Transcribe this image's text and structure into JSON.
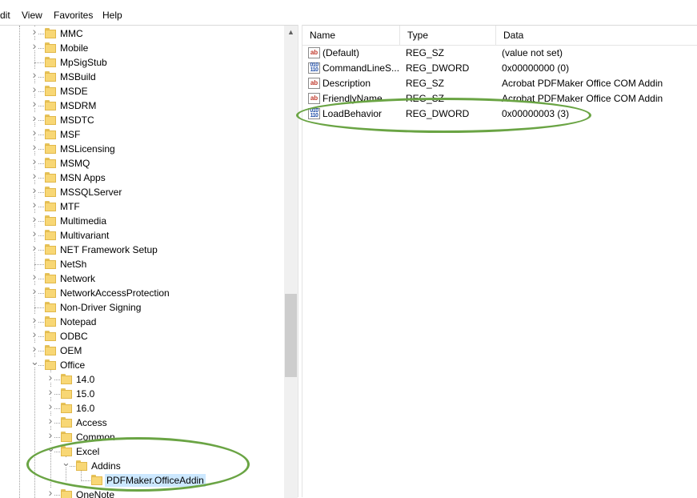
{
  "menu": {
    "items": [
      "dit",
      "View",
      "Favorites",
      "Help"
    ]
  },
  "tree": {
    "items": [
      {
        "label": "MMC",
        "depth": 0,
        "expander": "collapsed"
      },
      {
        "label": "Mobile",
        "depth": 0,
        "expander": "collapsed"
      },
      {
        "label": "MpSigStub",
        "depth": 0,
        "expander": "none"
      },
      {
        "label": "MSBuild",
        "depth": 0,
        "expander": "collapsed"
      },
      {
        "label": "MSDE",
        "depth": 0,
        "expander": "collapsed"
      },
      {
        "label": "MSDRM",
        "depth": 0,
        "expander": "collapsed"
      },
      {
        "label": "MSDTC",
        "depth": 0,
        "expander": "collapsed"
      },
      {
        "label": "MSF",
        "depth": 0,
        "expander": "collapsed"
      },
      {
        "label": "MSLicensing",
        "depth": 0,
        "expander": "collapsed"
      },
      {
        "label": "MSMQ",
        "depth": 0,
        "expander": "collapsed"
      },
      {
        "label": "MSN Apps",
        "depth": 0,
        "expander": "collapsed"
      },
      {
        "label": "MSSQLServer",
        "depth": 0,
        "expander": "collapsed"
      },
      {
        "label": "MTF",
        "depth": 0,
        "expander": "collapsed"
      },
      {
        "label": "Multimedia",
        "depth": 0,
        "expander": "collapsed"
      },
      {
        "label": "Multivariant",
        "depth": 0,
        "expander": "collapsed"
      },
      {
        "label": "NET Framework Setup",
        "depth": 0,
        "expander": "collapsed"
      },
      {
        "label": "NetSh",
        "depth": 0,
        "expander": "none"
      },
      {
        "label": "Network",
        "depth": 0,
        "expander": "collapsed"
      },
      {
        "label": "NetworkAccessProtection",
        "depth": 0,
        "expander": "collapsed"
      },
      {
        "label": "Non-Driver Signing",
        "depth": 0,
        "expander": "none"
      },
      {
        "label": "Notepad",
        "depth": 0,
        "expander": "collapsed"
      },
      {
        "label": "ODBC",
        "depth": 0,
        "expander": "collapsed"
      },
      {
        "label": "OEM",
        "depth": 0,
        "expander": "collapsed"
      },
      {
        "label": "Office",
        "depth": 0,
        "expander": "expanded"
      },
      {
        "label": "14.0",
        "depth": 1,
        "expander": "collapsed"
      },
      {
        "label": "15.0",
        "depth": 1,
        "expander": "collapsed"
      },
      {
        "label": "16.0",
        "depth": 1,
        "expander": "collapsed"
      },
      {
        "label": "Access",
        "depth": 1,
        "expander": "collapsed"
      },
      {
        "label": "Common",
        "depth": 1,
        "expander": "collapsed"
      },
      {
        "label": "Excel",
        "depth": 1,
        "expander": "expanded"
      },
      {
        "label": "Addins",
        "depth": 2,
        "expander": "expanded"
      },
      {
        "label": "PDFMaker.OfficeAddin",
        "depth": 3,
        "expander": "none",
        "selected": true
      },
      {
        "label": "OneNote",
        "depth": 1,
        "expander": "collapsed"
      }
    ]
  },
  "list": {
    "columns": [
      "Name",
      "Type",
      "Data"
    ],
    "rows": [
      {
        "icon": "string-value-icon",
        "name": "(Default)",
        "type": "REG_SZ",
        "data": "(value not set)"
      },
      {
        "icon": "dword-value-icon",
        "name": "CommandLineS...",
        "type": "REG_DWORD",
        "data": "0x00000000 (0)"
      },
      {
        "icon": "string-value-icon",
        "name": "Description",
        "type": "REG_SZ",
        "data": "Acrobat PDFMaker Office COM Addin"
      },
      {
        "icon": "string-value-icon",
        "name": "FriendlyName",
        "type": "REG_SZ",
        "data": "Acrobat PDFMaker Office COM Addin"
      },
      {
        "icon": "dword-value-icon",
        "name": "LoadBehavior",
        "type": "REG_DWORD",
        "data": "0x00000003 (3)"
      }
    ],
    "icon_text": {
      "string": "ab",
      "dword": "010\n110"
    }
  },
  "colors": {
    "annotation": "#6aa444",
    "selection": "#cce8ff",
    "folder": "#f8d775"
  }
}
